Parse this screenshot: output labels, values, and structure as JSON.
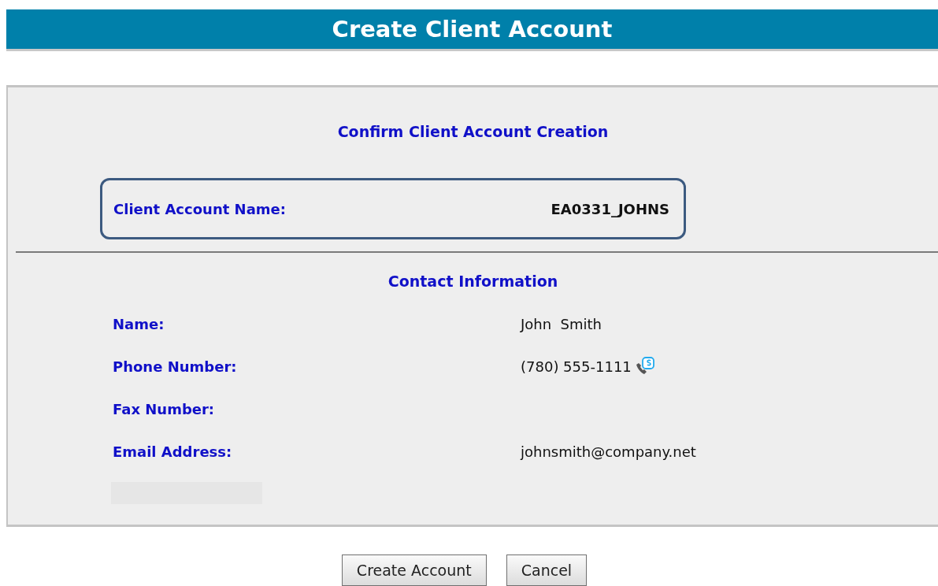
{
  "header": {
    "title": "Create Client Account"
  },
  "confirm": {
    "title": "Confirm Client Account Creation",
    "account_label": "Client Account Name:",
    "account_name": "EA0331_JOHNS"
  },
  "contact": {
    "title": "Contact Information",
    "rows": [
      {
        "kind": "text",
        "label": "Name:",
        "value": "John  Smith"
      },
      {
        "kind": "phone",
        "label": "Phone Number:",
        "value": "(780) 555-1111"
      },
      {
        "kind": "text",
        "label": "Fax Number:"
      },
      {
        "kind": "text",
        "label": "Email Address:",
        "value": "johnsmith@company.net"
      }
    ]
  },
  "buttons": [
    "Create Account",
    "Cancel"
  ]
}
